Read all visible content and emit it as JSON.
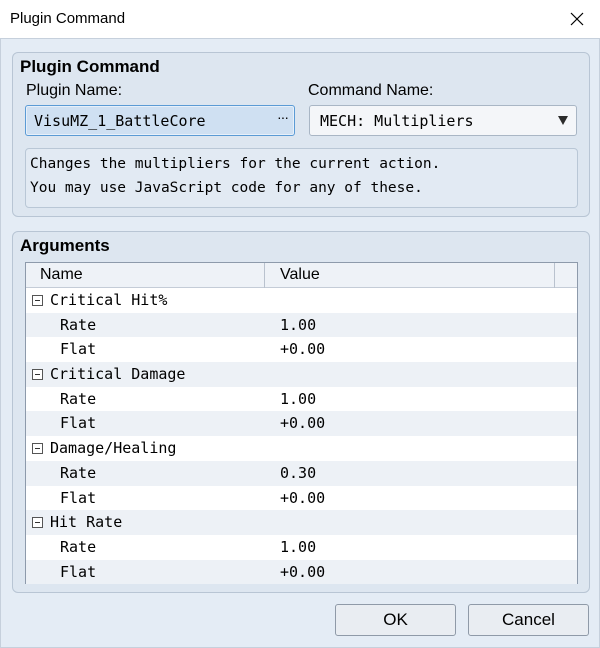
{
  "window": {
    "title": "Plugin Command",
    "close_icon": "close-icon"
  },
  "plugin_command": {
    "group_title": "Plugin Command",
    "plugin_name_label": "Plugin Name:",
    "plugin_name_value": "VisuMZ_1_BattleCore",
    "browse_label": "···",
    "command_name_label": "Command Name:",
    "command_name_value": "MECH: Multipliers",
    "description": [
      "Changes the multipliers for the current action.",
      "You may use JavaScript code for any of these."
    ]
  },
  "arguments": {
    "group_title": "Arguments",
    "columns": [
      "Name",
      "Value"
    ],
    "groups": [
      {
        "name": "Critical Hit%",
        "rows": [
          {
            "name": "Rate",
            "value": "1.00"
          },
          {
            "name": "Flat",
            "value": "+0.00"
          }
        ]
      },
      {
        "name": "Critical Damage",
        "rows": [
          {
            "name": "Rate",
            "value": "1.00"
          },
          {
            "name": "Flat",
            "value": "+0.00"
          }
        ]
      },
      {
        "name": "Damage/Healing",
        "rows": [
          {
            "name": "Rate",
            "value": "0.30"
          },
          {
            "name": "Flat",
            "value": "+0.00"
          }
        ]
      },
      {
        "name": "Hit Rate",
        "rows": [
          {
            "name": "Rate",
            "value": "1.00"
          },
          {
            "name": "Flat",
            "value": "+0.00"
          }
        ]
      }
    ]
  },
  "buttons": {
    "ok": "OK",
    "cancel": "Cancel"
  }
}
